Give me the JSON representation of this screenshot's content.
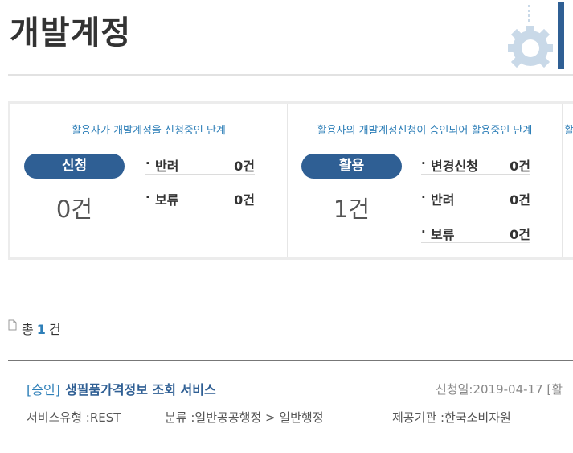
{
  "page": {
    "title": "개발계정"
  },
  "stages": [
    {
      "description": "활용자가 개발계정을 신청중인 단계",
      "label": "신청",
      "count": "0건",
      "sub": [
        {
          "label": "반려",
          "count": "0건"
        },
        {
          "label": "보류",
          "count": "0건"
        }
      ]
    },
    {
      "description": "활용자의 개발계정신청이 승인되어 활용중인 단계",
      "label": "활용",
      "count": "1건",
      "sub": [
        {
          "label": "변경신청",
          "count": "0건"
        },
        {
          "label": "반려",
          "count": "0건"
        },
        {
          "label": "보류",
          "count": "0건"
        }
      ]
    },
    {
      "description": "활"
    }
  ],
  "bullet": "·",
  "total": {
    "prefix": "총",
    "count": "1",
    "suffix": "건"
  },
  "items": [
    {
      "status": "[승인]",
      "name": "생필품가격정보 조회 서비스",
      "apply_date": "신청일:2019-04-17 [활",
      "service_type": "서비스유형 :REST",
      "category": "분류 :일반공공행정 > 일반행정",
      "provider": "제공기관 :한국소비자원"
    }
  ],
  "colors": {
    "accent": "#2e7fb8",
    "pill": "#2f5f94"
  },
  "icons": {
    "title_decoration": "gear-icon",
    "total": "document-icon"
  }
}
